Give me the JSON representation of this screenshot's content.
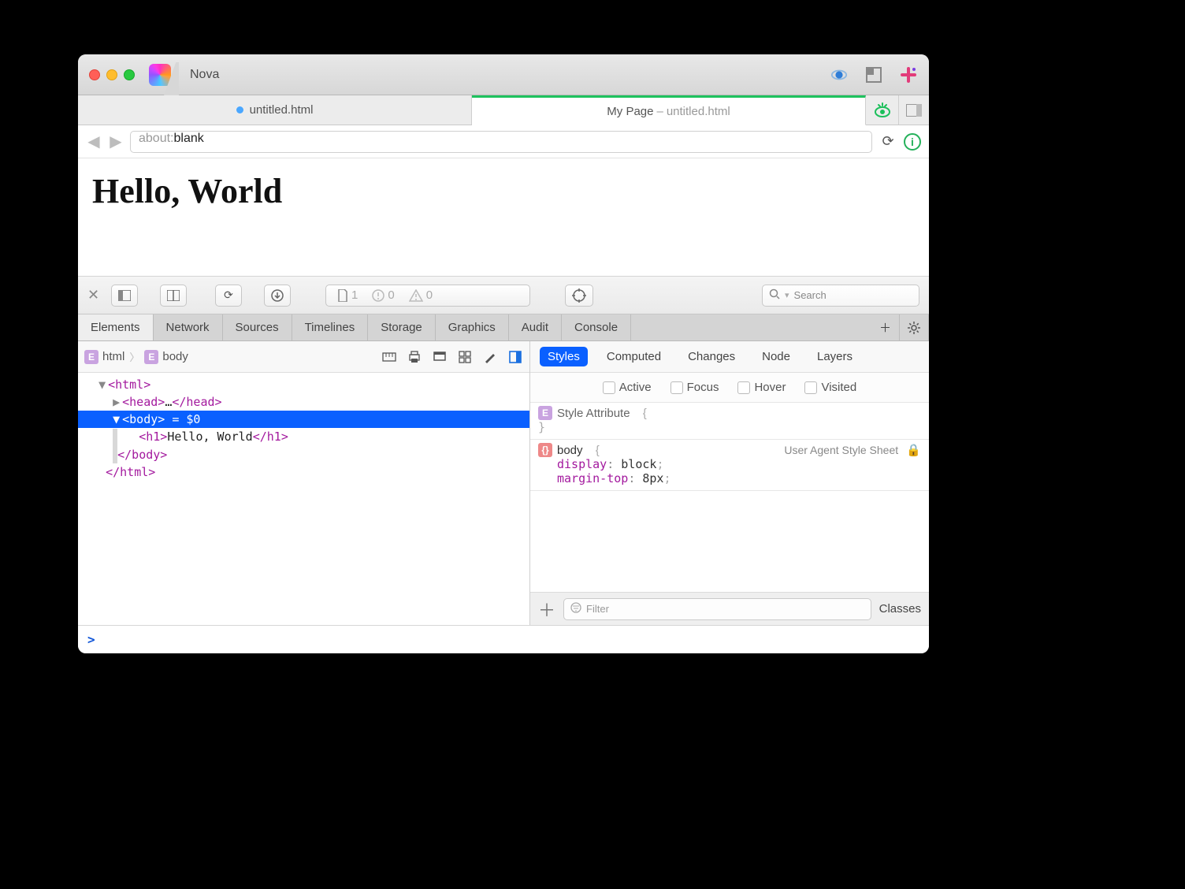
{
  "app": {
    "name": "Nova"
  },
  "doctabs": {
    "left": {
      "label": "untitled.html",
      "dirty": true
    },
    "right": {
      "title": "My Page",
      "sep": " – ",
      "file": "untitled.html"
    }
  },
  "url": {
    "value": "about:blank"
  },
  "preview": {
    "h1": "Hello, World"
  },
  "devbar": {
    "resources": "1",
    "errors": "0",
    "warnings": "0",
    "search_placeholder": "Search"
  },
  "devtabs": [
    "Elements",
    "Network",
    "Sources",
    "Timelines",
    "Storage",
    "Graphics",
    "Audit",
    "Console"
  ],
  "crumbs": {
    "a": "html",
    "b": "body"
  },
  "dom": {
    "html_open": "<html>",
    "head_open": "<head>",
    "head_ellipsis": "…",
    "head_close": "</head>",
    "body_open": "<body>",
    "body_eq": " = $0",
    "h1_open": "<h1>",
    "h1_text": "Hello, World",
    "h1_close": "</h1>",
    "body_close": "</body>",
    "html_close": "</html>"
  },
  "right": {
    "tabs": [
      "Styles",
      "Computed",
      "Changes",
      "Node",
      "Layers"
    ],
    "pseudo": [
      "Active",
      "Focus",
      "Hover",
      "Visited"
    ],
    "style_attr_label": "Style Attribute",
    "ua_label": "User Agent Style Sheet",
    "rule_selector": "body",
    "props": [
      {
        "name": "display",
        "value": "block"
      },
      {
        "name": "margin-top",
        "value": "8px"
      }
    ],
    "filter_placeholder": "Filter",
    "classes_label": "Classes"
  },
  "console_prompt": ">"
}
